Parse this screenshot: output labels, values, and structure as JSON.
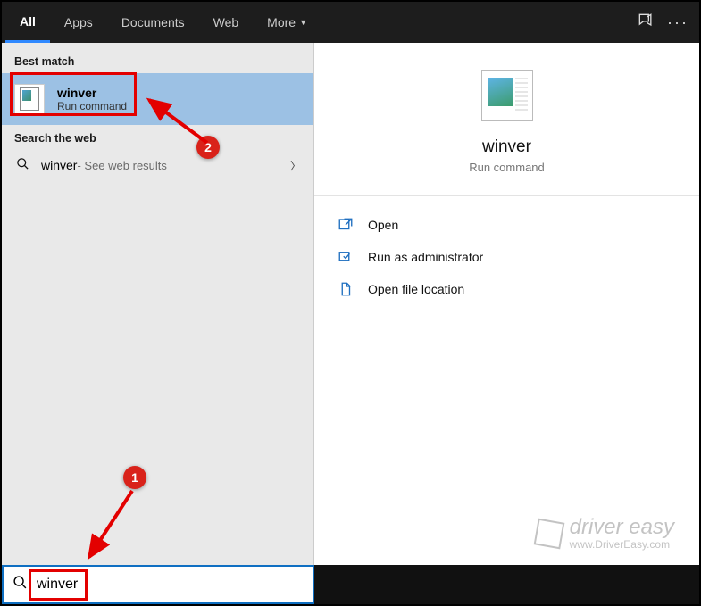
{
  "topbar": {
    "tabs": {
      "all": "All",
      "apps": "Apps",
      "documents": "Documents",
      "web": "Web",
      "more": "More"
    }
  },
  "left": {
    "best_match_header": "Best match",
    "best_match": {
      "title": "winver",
      "subtitle": "Run command"
    },
    "search_web_header": "Search the web",
    "web_result": {
      "term": "winver",
      "suffix": " - See web results"
    }
  },
  "right": {
    "title": "winver",
    "subtitle": "Run command",
    "actions": {
      "open": "Open",
      "run_admin": "Run as administrator",
      "open_location": "Open file location"
    }
  },
  "search": {
    "value": "winver"
  },
  "annotations": {
    "callout1": "1",
    "callout2": "2"
  },
  "watermark": {
    "line1": "driver easy",
    "line2": "www.DriverEasy.com"
  }
}
